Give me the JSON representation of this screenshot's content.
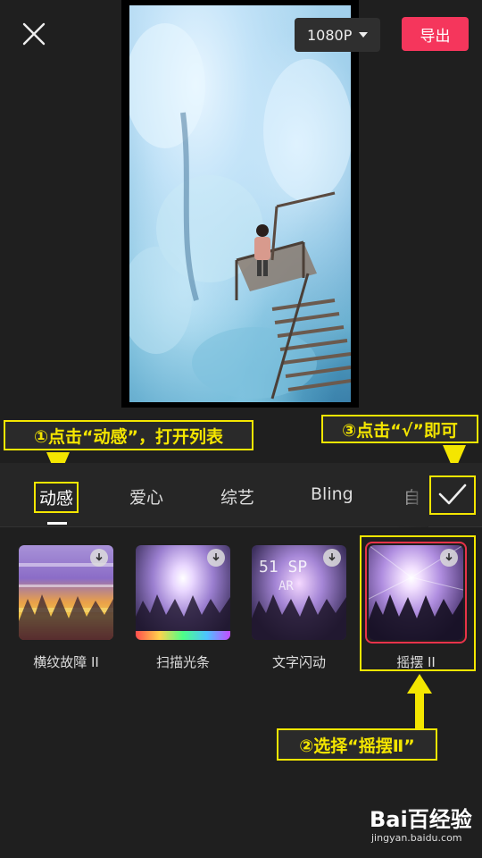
{
  "header": {
    "resolution": "1080P",
    "export_label": "导出"
  },
  "annotations": {
    "step1": "①点击“动感”，打开列表",
    "step2": "②选择“摇摆Ⅱ”",
    "step3": "③点击“√”即可"
  },
  "tabs": [
    {
      "label": "动感",
      "active": true
    },
    {
      "label": "爱心",
      "active": false
    },
    {
      "label": "综艺",
      "active": false
    },
    {
      "label": "Bling",
      "active": false
    },
    {
      "label": "自",
      "active": false
    }
  ],
  "effects": [
    {
      "label": "横纹故障 II",
      "selected": false
    },
    {
      "label": "扫描光条",
      "selected": false
    },
    {
      "label": "文字闪动",
      "selected": false
    },
    {
      "label": "摇摆 II",
      "selected": true
    }
  ],
  "thumb_text": {
    "line1": "51 SP",
    "line2": "AR"
  },
  "watermark": {
    "brand": "Bai百经验",
    "url": "jingyan.baidu.com"
  },
  "colors": {
    "accent": "#f5365c",
    "annotation": "#f4e600",
    "selected_border": "#e8334a"
  }
}
